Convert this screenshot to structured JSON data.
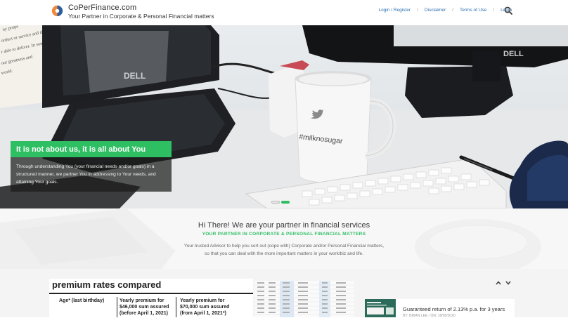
{
  "header": {
    "brand_name": "CoPerFinance.com",
    "brand_tagline": "Your Partner in Corporate & Personal Financial matters",
    "nav": [
      "Login / Register",
      "Disclaimer",
      "Terms of Use",
      "Login"
    ],
    "search_icon": "search-icon"
  },
  "hero": {
    "caption_title": "It is not about us, it is all about You",
    "caption_body": "Through understanding You (your financial needs and/or goals) in a structured manner, we partner You in addressing to Your needs, and attaining Your goals.",
    "mug_text": "#milknosugar",
    "monitor_brand": "DELL",
    "paper_text": [
      "ny prope",
      "orduct or service and then",
      "r able to deliver. In summary, we",
      "our greatness and",
      "world."
    ],
    "slides": 2,
    "active_slide": 2
  },
  "intro": {
    "heading": "Hi There! We are your partner in financial services",
    "subheading": "YOUR PARTNER IN CORPORATE & PERSONAL FINANCIAL MATTERS",
    "line1": "Your trusted Advisor to help you sort out (cope with) Corporate and/or Personal Financial matters,",
    "line2": "so that you can deal with the more important matters in your work/biz and life."
  },
  "featured": {
    "image_title": "premium rates compared",
    "col1": "Age* (last birthday)",
    "col2": [
      "Yearly premium for",
      "$46,000 sum assured",
      "(before April 1, 2021)"
    ],
    "col3": [
      "Yearly premium for",
      "$70,000 sum assured",
      "(from April 1, 2021*)"
    ]
  },
  "news": {
    "title": "Guaranteed return of 2.13% p.a. for 3 years",
    "meta": "BY: BRIAN LEE  /  ON: 18/05/2020"
  },
  "colors": {
    "accent_green": "#2fbf63",
    "link_blue": "#2a6fb0",
    "logo_orange": "#f0883a",
    "logo_blue": "#2b5f9e"
  }
}
